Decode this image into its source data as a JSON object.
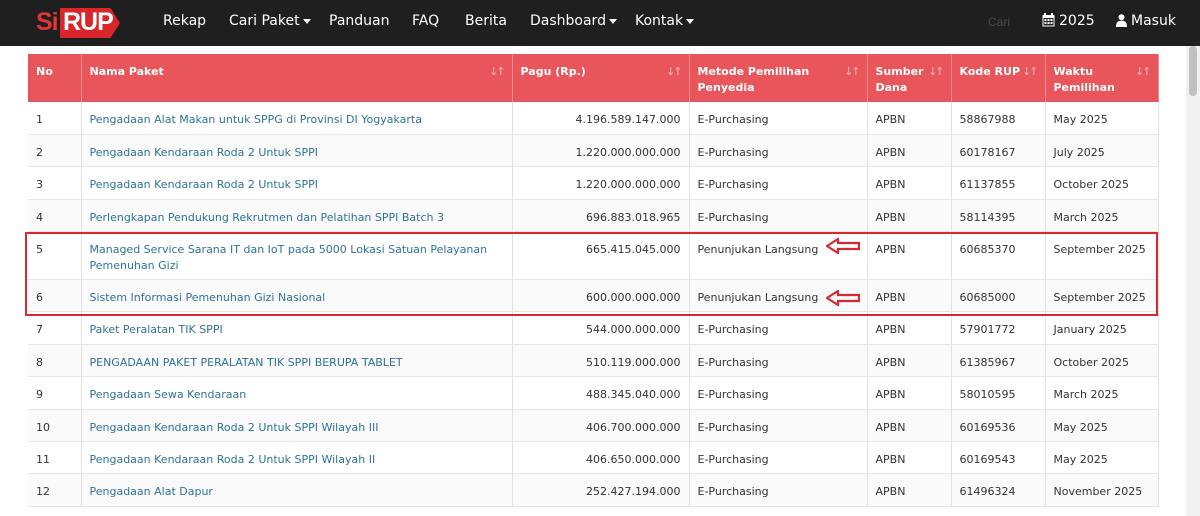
{
  "nav": {
    "logo_prefix": "Si",
    "logo_main": "RUP",
    "items": [
      {
        "label": "Rekap",
        "dropdown": false
      },
      {
        "label": "Cari Paket",
        "dropdown": true
      },
      {
        "label": "Panduan",
        "dropdown": false
      },
      {
        "label": "FAQ",
        "dropdown": false
      },
      {
        "label": "Berita",
        "dropdown": false
      },
      {
        "label": "Dashboard",
        "dropdown": true
      },
      {
        "label": "Kontak",
        "dropdown": true
      }
    ],
    "search_placeholder": "Cari",
    "year": "2025",
    "login": "Masuk"
  },
  "table": {
    "headers": [
      {
        "line1": "No",
        "line2": ""
      },
      {
        "line1": "Nama Paket",
        "line2": ""
      },
      {
        "line1": "Pagu (Rp.)",
        "line2": ""
      },
      {
        "line1": "Metode Pemilihan",
        "line2": "Penyedia"
      },
      {
        "line1": "Sumber",
        "line2": "Dana"
      },
      {
        "line1": "Kode RUP",
        "line2": ""
      },
      {
        "line1": "Waktu",
        "line2": "Pemilihan"
      }
    ],
    "rows": [
      {
        "no": "1",
        "nama_line1": "Pengadaan Alat Makan untuk SPPG di Provinsi DI Yogyakarta",
        "nama_line2": "",
        "pagu": "4.196.589.147.000",
        "metode": "E-Purchasing",
        "sumber": "APBN",
        "kode": "58867988",
        "waktu": "May 2025"
      },
      {
        "no": "2",
        "nama_line1": "Pengadaan Kendaraan Roda 2 Untuk SPPI",
        "nama_line2": "",
        "pagu": "1.220.000.000.000",
        "metode": "E-Purchasing",
        "sumber": "APBN",
        "kode": "60178167",
        "waktu": "July 2025"
      },
      {
        "no": "3",
        "nama_line1": "Pengadaan Kendaraan Roda 2 Untuk SPPI",
        "nama_line2": "",
        "pagu": "1.220.000.000.000",
        "metode": "E-Purchasing",
        "sumber": "APBN",
        "kode": "61137855",
        "waktu": "October 2025"
      },
      {
        "no": "4",
        "nama_line1": "Perlengkapan Pendukung Rekrutmen dan Pelatihan SPPI Batch 3",
        "nama_line2": "",
        "pagu": "696.883.018.965",
        "metode": "E-Purchasing",
        "sumber": "APBN",
        "kode": "58114395",
        "waktu": "March 2025"
      },
      {
        "no": "5",
        "nama_line1": "Managed Service Sarana IT dan IoT pada 5000 Lokasi Satuan Pelayanan",
        "nama_line2": "Pemenuhan Gizi",
        "pagu": "665.415.045.000",
        "metode": "Penunjukan Langsung",
        "sumber": "APBN",
        "kode": "60685370",
        "waktu": "September 2025"
      },
      {
        "no": "6",
        "nama_line1": "Sistem Informasi Pemenuhan Gizi Nasional",
        "nama_line2": "",
        "pagu": "600.000.000.000",
        "metode": "Penunjukan Langsung",
        "sumber": "APBN",
        "kode": "60685000",
        "waktu": "September 2025"
      },
      {
        "no": "7",
        "nama_line1": "Paket Peralatan TIK SPPI",
        "nama_line2": "",
        "pagu": "544.000.000.000",
        "metode": "E-Purchasing",
        "sumber": "APBN",
        "kode": "57901772",
        "waktu": "January 2025"
      },
      {
        "no": "8",
        "nama_line1": "PENGADAAN PAKET PERALATAN TIK SPPI BERUPA TABLET",
        "nama_line2": "",
        "pagu": "510.119.000.000",
        "metode": "E-Purchasing",
        "sumber": "APBN",
        "kode": "61385967",
        "waktu": "October 2025"
      },
      {
        "no": "9",
        "nama_line1": "Pengadaan Sewa Kendaraan",
        "nama_line2": "",
        "pagu": "488.345.040.000",
        "metode": "E-Purchasing",
        "sumber": "APBN",
        "kode": "58010595",
        "waktu": "March 2025"
      },
      {
        "no": "10",
        "nama_line1": "Pengadaan Kendaraan Roda 2 Untuk SPPI Wilayah III",
        "nama_line2": "",
        "pagu": "406.700.000.000",
        "metode": "E-Purchasing",
        "sumber": "APBN",
        "kode": "60169536",
        "waktu": "May 2025"
      },
      {
        "no": "11",
        "nama_line1": "Pengadaan Kendaraan Roda 2 Untuk SPPI Wilayah II",
        "nama_line2": "",
        "pagu": "406.650.000.000",
        "metode": "E-Purchasing",
        "sumber": "APBN",
        "kode": "60169543",
        "waktu": "May 2025"
      },
      {
        "no": "12",
        "nama_line1": "Pengadaan Alat Dapur",
        "nama_line2": "",
        "pagu": "252.427.194.000",
        "metode": "E-Purchasing",
        "sumber": "APBN",
        "kode": "61496324",
        "waktu": "November 2025"
      }
    ]
  },
  "colors": {
    "navbar": "#1f1f1f",
    "header": "#e8555a",
    "link": "#2f7396",
    "annotation": "#d42a30"
  }
}
